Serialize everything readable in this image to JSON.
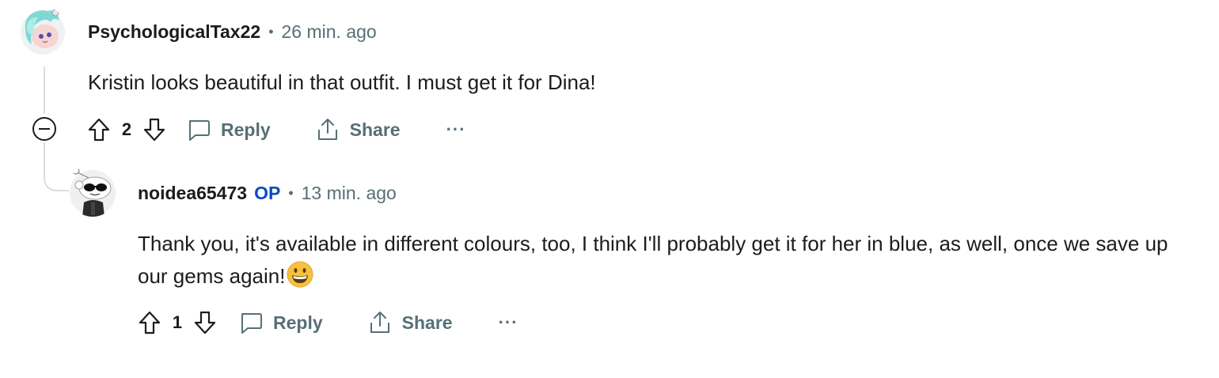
{
  "comments": [
    {
      "username": "PsychologicalTax22",
      "separator": "•",
      "time": "26 min. ago",
      "text": "Kristin looks beautiful in that outfit. I must get it for Dina!",
      "score": "2",
      "reply_label": "Reply",
      "share_label": "Share",
      "more_label": "···",
      "avatar_icon": "snoo-avatar-teal-hair-icon",
      "collapse_icon": "collapse-thread-icon"
    },
    {
      "username": "noidea65473",
      "op_badge": "OP",
      "separator": "•",
      "time": "13 min. ago",
      "text": "Thank you, it's available in different colours, too, I think I'll probably get it for her in blue, as well, once we save up our gems again!",
      "emoji": "grinning-face-emoji",
      "score": "1",
      "reply_label": "Reply",
      "share_label": "Share",
      "more_label": "···",
      "avatar_icon": "snoo-avatar-sunglasses-icon"
    }
  ],
  "colors": {
    "meta_gray": "#576f76",
    "op_blue": "#0a4bc2",
    "thread_line": "#d7dde0",
    "text": "#1c1c1c"
  }
}
